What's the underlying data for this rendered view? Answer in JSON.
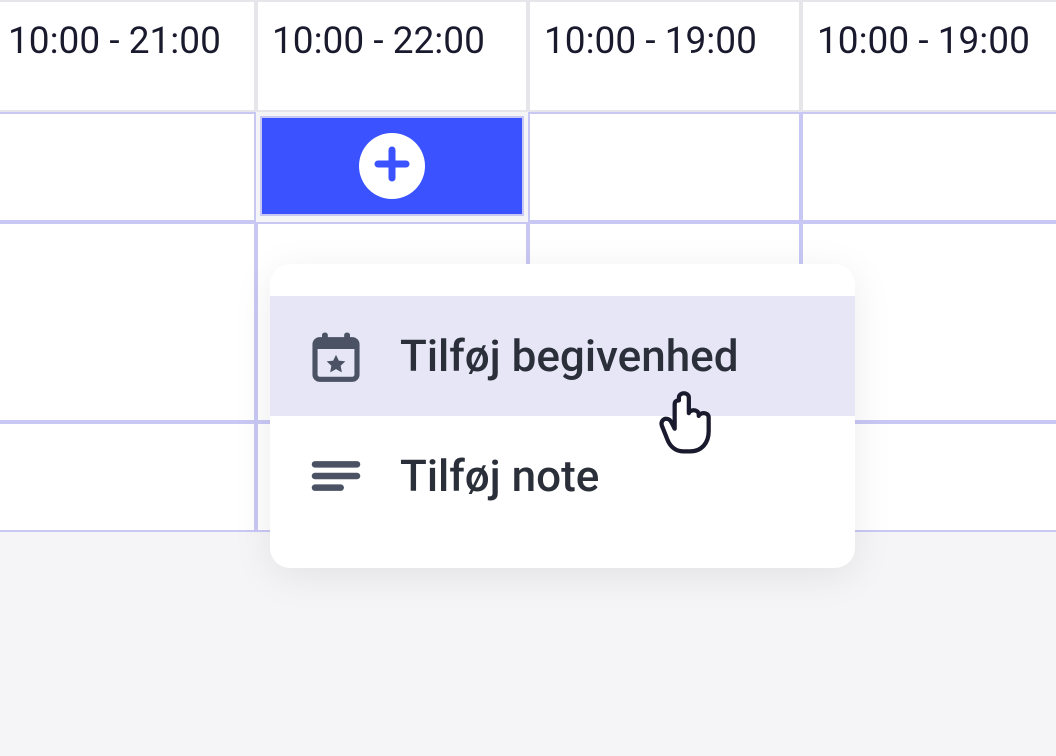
{
  "grid": {
    "headers": [
      "10:00 - 21:00",
      "10:00 - 22:00",
      "10:00 - 19:00",
      "10:00 - 19:00"
    ]
  },
  "menu": {
    "items": [
      {
        "label": "Tilføj begivenhed"
      },
      {
        "label": "Tilføj note"
      }
    ]
  }
}
